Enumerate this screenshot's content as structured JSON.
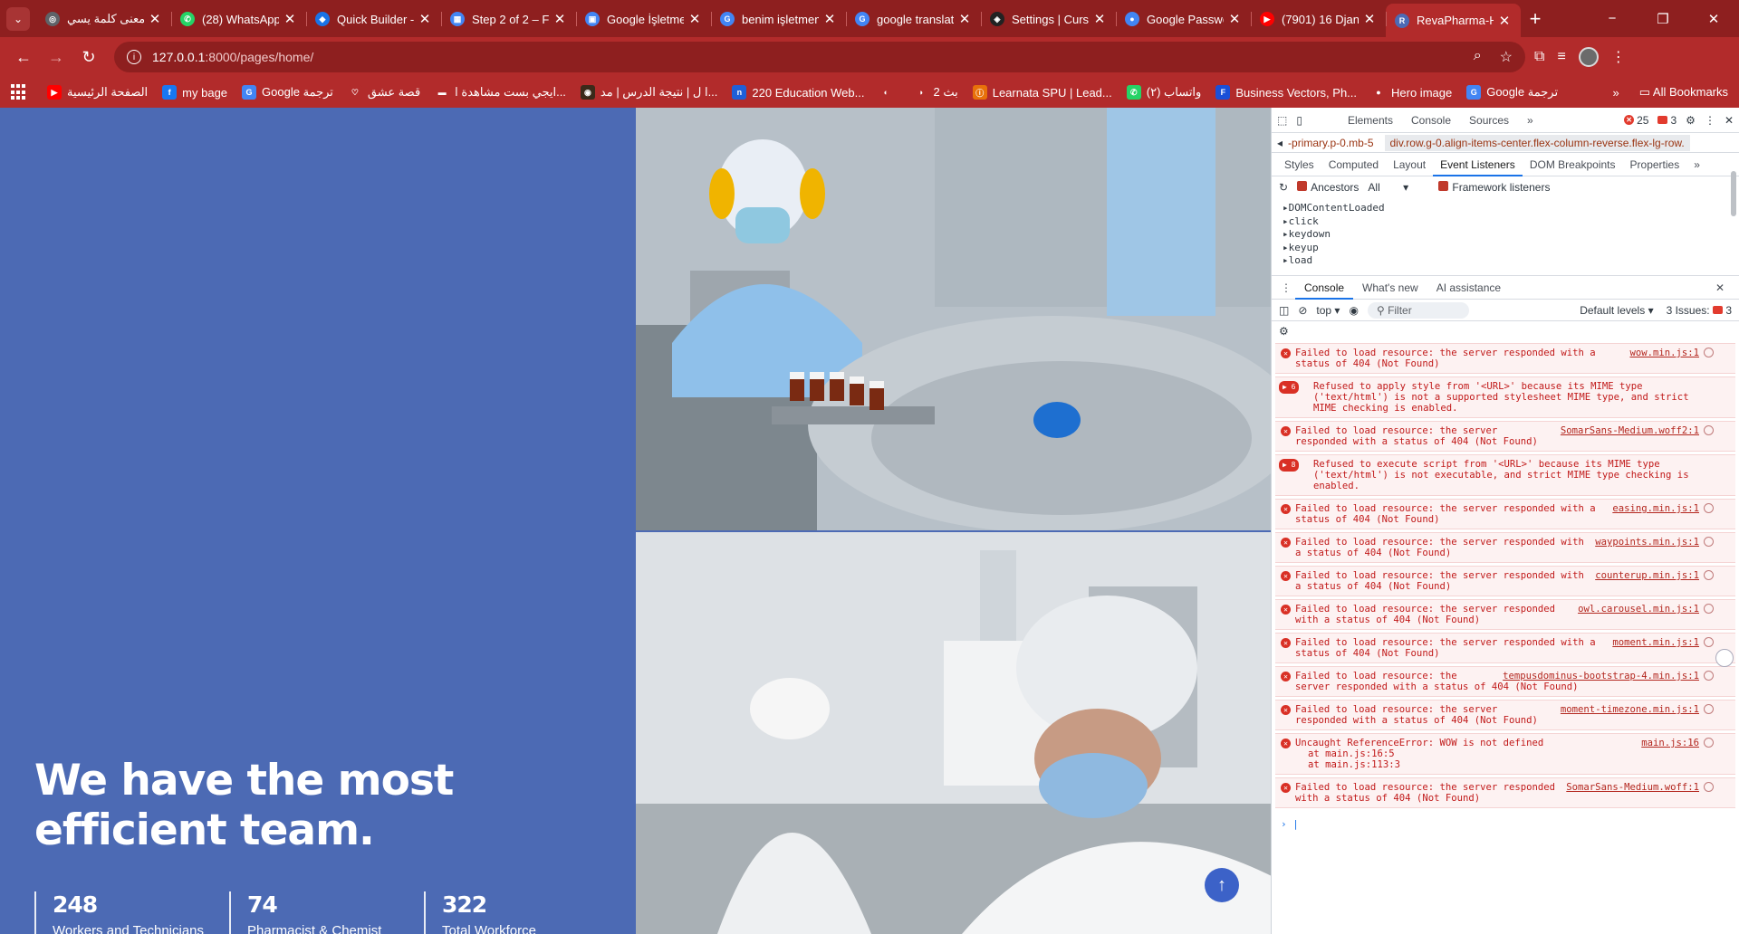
{
  "browser": {
    "tabs": [
      {
        "title": "معنى كلمة يسي",
        "fav_color": "#5f6368",
        "fav_glyph": "◎"
      },
      {
        "title": "(28) WhatsApp",
        "fav_color": "#25d366",
        "fav_glyph": "✆"
      },
      {
        "title": "Quick Builder -",
        "fav_color": "#1a73e8",
        "fav_glyph": "◆"
      },
      {
        "title": "Step 2 of 2 – Fr",
        "fav_color": "#4285f4",
        "fav_glyph": "▦"
      },
      {
        "title": "Google İşletme",
        "fav_color": "#4285f4",
        "fav_glyph": "▣"
      },
      {
        "title": "benim işletmem",
        "fav_color": "#4285f4",
        "fav_glyph": "G"
      },
      {
        "title": "google translat",
        "fav_color": "#4285f4",
        "fav_glyph": "G"
      },
      {
        "title": "Settings | Curs",
        "fav_color": "#222222",
        "fav_glyph": "◈"
      },
      {
        "title": "Google Passwo",
        "fav_color": "#4285f4",
        "fav_glyph": "●"
      },
      {
        "title": "(7901) 16 Djan",
        "fav_color": "#ff0000",
        "fav_glyph": "▶"
      },
      {
        "title": "RevaPharma-H",
        "fav_color": "#4c6ab4",
        "fav_glyph": "R",
        "active": true
      }
    ],
    "new_tab": "+",
    "window_controls": [
      "−",
      "❐",
      "✕"
    ],
    "url": {
      "host": "127.0.0.1",
      "path": ":8000/pages/home/"
    },
    "bookmarks": [
      {
        "label": "الصفحة الرئيسية",
        "color": "#ff0000",
        "glyph": "▶"
      },
      {
        "label": "my bage",
        "color": "#1877f2",
        "glyph": "f"
      },
      {
        "label": "Google ترجمة",
        "color": "#4285f4",
        "glyph": "G"
      },
      {
        "label": "قصة عشق",
        "color": "#b22b2b",
        "glyph": "♡"
      },
      {
        "label": "ايجي بست مشاهدة ا...",
        "color": "#ffffff",
        "glyph": "▬"
      },
      {
        "label": "ا ل | نتيجة الدرس | مد...",
        "color": "#3b2a1a",
        "glyph": "◉"
      },
      {
        "label": "220 Education Web...",
        "color": "#1e5fd8",
        "glyph": "n"
      },
      {
        "label": "",
        "color": "#ffffff",
        "glyph": "◐"
      },
      {
        "label": "2 بث",
        "color": "#ffffff",
        "glyph": "◑"
      },
      {
        "label": "Learnata SPU | Lead...",
        "color": "#e8710a",
        "glyph": "ⓘ"
      },
      {
        "label": "واتساب (٢)",
        "color": "#25d366",
        "glyph": "✆"
      },
      {
        "label": "Business Vectors, Ph...",
        "color": "#1a4fd8",
        "glyph": "F"
      },
      {
        "label": "Hero image",
        "color": "#ffffff",
        "glyph": "●"
      },
      {
        "label": "Google ترجمة",
        "color": "#4285f4",
        "glyph": "G"
      }
    ],
    "bookmarks_more": "»",
    "all_bookmarks": "All Bookmarks"
  },
  "page": {
    "headline": "We have the most efficient team.",
    "stats": [
      {
        "value": "248",
        "label": "Workers and Technicians"
      },
      {
        "value": "74",
        "label": "Pharmacist & Chemist"
      },
      {
        "value": "322",
        "label": "Total Workforce"
      }
    ],
    "scroll_top": "↑"
  },
  "devtools": {
    "main_tabs": [
      "Elements",
      "Console",
      "Sources"
    ],
    "more": "»",
    "error_count": "25",
    "issue_count": "3",
    "crumb_parent": "-primary.p-0.mb-5",
    "crumb_current": "div.row.g-0.align-items-center.flex-column-reverse.flex-lg-row.",
    "sub_tabs": [
      "Styles",
      "Computed",
      "Layout",
      "Event Listeners",
      "DOM Breakpoints",
      "Properties"
    ],
    "sub_tab_active": "Event Listeners",
    "ev_options": {
      "ancestors": "Ancestors",
      "filter": "All",
      "framework": "Framework listeners"
    },
    "event_listeners": [
      "DOMContentLoaded",
      "click",
      "keydown",
      "keyup",
      "load"
    ],
    "drawer_tabs": [
      "Console",
      "What's new",
      "AI assistance"
    ],
    "console_context": "top",
    "filter_placeholder": "Filter",
    "levels": "Default levels",
    "issues": "3 Issues:",
    "issues_count": "3",
    "messages": [
      {
        "text": "Failed to load resource: the server responded with a status of 404 (Not Found)",
        "src": "wow.min.js:1"
      },
      {
        "count": "6",
        "text": "Refused to apply style from '<URL>' because its MIME type ('text/html') is not a supported stylesheet MIME type, and strict MIME checking is enabled.",
        "src": ""
      },
      {
        "text": "Failed to load resource: the server responded with a status of 404 (Not Found)",
        "src": "SomarSans-Medium.woff2:1"
      },
      {
        "count": "8",
        "text": "Refused to execute script from '<URL>' because its MIME type ('text/html') is not executable, and strict MIME type checking is enabled.",
        "src": ""
      },
      {
        "text": "Failed to load resource: the server responded with a status of 404 (Not Found)",
        "src": "easing.min.js:1"
      },
      {
        "text": "Failed to load resource: the server responded with a status of 404 (Not Found)",
        "src": "waypoints.min.js:1"
      },
      {
        "text": "Failed to load resource: the server responded with a status of 404 (Not Found)",
        "src": "counterup.min.js:1"
      },
      {
        "text": "Failed to load resource: the server responded with a status of 404 (Not Found)",
        "src": "owl.carousel.min.js:1"
      },
      {
        "text": "Failed to load resource: the server responded with a status of 404 (Not Found)",
        "src": "moment.min.js:1"
      },
      {
        "text": "Failed to load resource: the server responded with a status of 404 (Not Found)",
        "src": "tempusdominus-bootstrap-4.min.js:1"
      },
      {
        "text": "Failed to load resource: the server responded with a status of 404 (Not Found)",
        "src": "moment-timezone.min.js:1"
      },
      {
        "text": "Uncaught ReferenceError: WOW is not defined",
        "src": "main.js:16",
        "stack": [
          "at main.js:16:5",
          "at main.js:113:3"
        ]
      },
      {
        "text": "Failed to load resource: the server responded with a status of 404 (Not Found)",
        "src": "SomarSans-Medium.woff:1"
      }
    ],
    "prompt": "›"
  }
}
